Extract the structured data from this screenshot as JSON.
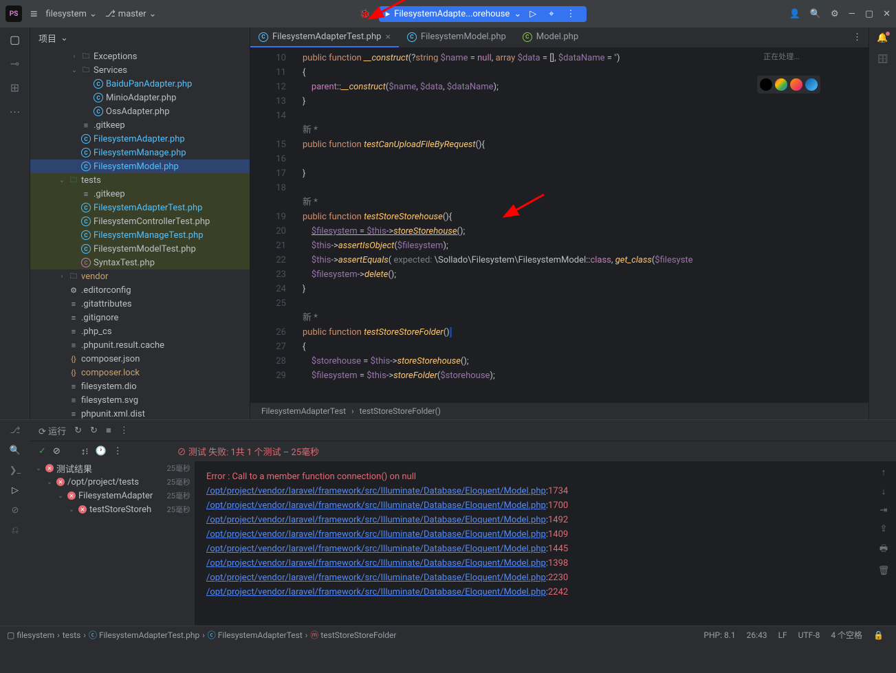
{
  "titlebar": {
    "project_name": "filesystem",
    "branch": "master",
    "run_config": "FilesystemAdapte...orehouse"
  },
  "project_panel": {
    "header": "项目",
    "tree": [
      {
        "indent": 2,
        "chev": "›",
        "icon": "folder",
        "label": "Exceptions",
        "cls": ""
      },
      {
        "indent": 2,
        "chev": "⌄",
        "icon": "folder",
        "label": "Services",
        "cls": ""
      },
      {
        "indent": 3,
        "chev": "",
        "icon": "php",
        "label": "BaiduPanAdapter.php",
        "cls": "blue"
      },
      {
        "indent": 3,
        "chev": "",
        "icon": "php",
        "label": "MinioAdapter.php",
        "cls": ""
      },
      {
        "indent": 3,
        "chev": "",
        "icon": "php",
        "label": "OssAdapter.php",
        "cls": ""
      },
      {
        "indent": 2,
        "chev": "",
        "icon": "file",
        "label": ".gitkeep",
        "cls": ""
      },
      {
        "indent": 2,
        "chev": "",
        "icon": "php",
        "label": "FilesystemAdapter.php",
        "cls": "blue"
      },
      {
        "indent": 2,
        "chev": "",
        "icon": "php",
        "label": "FilesystemManage.php",
        "cls": "blue"
      },
      {
        "indent": 2,
        "chev": "",
        "icon": "php",
        "label": "FilesystemModel.php",
        "cls": "blue",
        "selected": true
      },
      {
        "indent": 1,
        "chev": "⌄",
        "icon": "folder-green",
        "label": "tests",
        "cls": "",
        "hl": true
      },
      {
        "indent": 2,
        "chev": "",
        "icon": "file",
        "label": ".gitkeep",
        "cls": "",
        "hl": true
      },
      {
        "indent": 2,
        "chev": "",
        "icon": "php",
        "label": "FilesystemAdapterTest.php",
        "cls": "blue",
        "hl": true
      },
      {
        "indent": 2,
        "chev": "",
        "icon": "php",
        "label": "FilesystemControllerTest.php",
        "cls": "",
        "hl": true
      },
      {
        "indent": 2,
        "chev": "",
        "icon": "php",
        "label": "FilesystemManageTest.php",
        "cls": "blue",
        "hl": true
      },
      {
        "indent": 2,
        "chev": "",
        "icon": "php",
        "label": "FilesystemModelTest.php",
        "cls": "",
        "hl": true
      },
      {
        "indent": 2,
        "chev": "",
        "icon": "php-purple",
        "label": "SyntaxTest.php",
        "cls": "",
        "hl": true
      },
      {
        "indent": 1,
        "chev": "›",
        "icon": "folder",
        "label": "vendor",
        "cls": "yellow"
      },
      {
        "indent": 1,
        "chev": "",
        "icon": "gear",
        "label": ".editorconfig",
        "cls": ""
      },
      {
        "indent": 1,
        "chev": "",
        "icon": "file",
        "label": ".gitattributes",
        "cls": ""
      },
      {
        "indent": 1,
        "chev": "",
        "icon": "file",
        "label": ".gitignore",
        "cls": ""
      },
      {
        "indent": 1,
        "chev": "",
        "icon": "file",
        "label": ".php_cs",
        "cls": ""
      },
      {
        "indent": 1,
        "chev": "",
        "icon": "file",
        "label": ".phpunit.result.cache",
        "cls": ""
      },
      {
        "indent": 1,
        "chev": "",
        "icon": "json",
        "label": "composer.json",
        "cls": ""
      },
      {
        "indent": 1,
        "chev": "",
        "icon": "json",
        "label": "composer.lock",
        "cls": "yellow"
      },
      {
        "indent": 1,
        "chev": "",
        "icon": "file",
        "label": "filesystem.dio",
        "cls": ""
      },
      {
        "indent": 1,
        "chev": "",
        "icon": "file",
        "label": "filesystem.svg",
        "cls": ""
      },
      {
        "indent": 1,
        "chev": "",
        "icon": "file",
        "label": "phpunit.xml.dist",
        "cls": ""
      }
    ]
  },
  "tabs": [
    {
      "icon": "php",
      "label": "FilesystemAdapterTest.php",
      "active": true,
      "closable": true
    },
    {
      "icon": "php",
      "label": "FilesystemModel.php",
      "active": false,
      "closable": false
    },
    {
      "icon": "php-green",
      "label": "Model.php",
      "active": false,
      "closable": false
    }
  ],
  "status_processing": "正在处理...",
  "gutter_lines": [
    "10",
    "11",
    "12",
    "13",
    "14",
    "",
    "15",
    "16",
    "17",
    "18",
    "",
    "19",
    "20",
    "21",
    "22",
    "23",
    "24",
    "25",
    "",
    "26",
    "27",
    "28",
    "29"
  ],
  "code_lines": [
    {
      "html": "<span class='kw'>public</span> <span class='kw'>function</span> <span class='fn'>__construct</span>(?<span class='type'>string</span> <span class='var'>$name</span> = <span class='const'>null</span>, <span class='type'>array</span> <span class='var'>$data</span> = [], <span class='var'>$dataName</span> = <span class='str'>''</span>)"
    },
    {
      "html": "{"
    },
    {
      "html": "    <span class='const'>parent</span>::<span class='fn'>__construct</span>(<span class='var'>$name</span>, <span class='var'>$data</span>, <span class='var'>$dataName</span>);"
    },
    {
      "html": "}"
    },
    {
      "html": ""
    },
    {
      "html": "<span class='cmt'>新 *</span>"
    },
    {
      "html": "<span class='kw'>public</span> <span class='kw'>function</span> <span class='fn'>testCanUploadFileByRequest</span>(){"
    },
    {
      "html": ""
    },
    {
      "html": "}"
    },
    {
      "html": ""
    },
    {
      "html": "<span class='cmt'>新 *</span>"
    },
    {
      "html": "<span class='kw'>public</span> <span class='kw'>function</span> <span class='fn'>testStoreStorehouse</span>(){"
    },
    {
      "html": "    <span style='text-decoration:underline'><span class='var'>$filesystem</span> = <span class='var'>$this</span>-><span class='fn'>storeStorehouse</span>();</span>"
    },
    {
      "html": "    <span class='var'>$this</span>-><span class='fn'>assertIsObject</span>(<span class='var'>$filesystem</span>);"
    },
    {
      "html": "    <span class='var'>$this</span>-><span class='fn'>assertEquals</span>( <span class='param'>expected:</span> \\Sollado\\Filesystem\\<span class='op'>FilesystemModel</span>::<span class='const'>class</span>, <span class='fn'>get_class</span>(<span class='var'>$filesyste</span>"
    },
    {
      "html": "    <span class='var'>$filesystem</span>-><span class='fn'>delete</span>();"
    },
    {
      "html": "}"
    },
    {
      "html": ""
    },
    {
      "html": "<span class='cmt'>新 *</span>"
    },
    {
      "html": "<span class='kw'>public</span> <span class='kw'>function</span> <span class='fn'>testStoreStoreFolder</span>()<span style='background:#214283'>&nbsp;</span>"
    },
    {
      "html": "{"
    },
    {
      "html": "    <span class='var'>$storehouse</span> = <span class='var'>$this</span>-><span class='fn'>storeStorehouse</span>();"
    },
    {
      "html": "    <span class='var'>$filesystem</span> = <span class='var'>$this</span>-><span class='fn'>storeFolder</span>(<span class='var'>$storehouse</span>);"
    }
  ],
  "editor_breadcrumb": {
    "class": "FilesystemAdapterTest",
    "method": "testStoreStoreFolder()"
  },
  "run_toolbar": {
    "label": "运行"
  },
  "test_status": "测试 失败: 1共 1 个测试 – 25毫秒",
  "test_tree": [
    {
      "indent": 0,
      "label": "测试结果",
      "time": "25毫秒"
    },
    {
      "indent": 1,
      "label": "/opt/project/tests",
      "time": "25毫秒"
    },
    {
      "indent": 2,
      "label": "FilesystemAdapter",
      "time": "25毫秒"
    },
    {
      "indent": 3,
      "label": "testStoreStoreh",
      "time": "25毫秒"
    }
  ],
  "test_output": {
    "error": "Error : Call to a member function connection() on null",
    "stack": [
      {
        "path": "/opt/project/vendor/laravel/framework/src/Illuminate/Database/Eloquent/Model.php",
        "line": "1734"
      },
      {
        "path": "/opt/project/vendor/laravel/framework/src/Illuminate/Database/Eloquent/Model.php",
        "line": "1700"
      },
      {
        "path": "/opt/project/vendor/laravel/framework/src/Illuminate/Database/Eloquent/Model.php",
        "line": "1492"
      },
      {
        "path": "/opt/project/vendor/laravel/framework/src/Illuminate/Database/Eloquent/Model.php",
        "line": "1409"
      },
      {
        "path": "/opt/project/vendor/laravel/framework/src/Illuminate/Database/Eloquent/Model.php",
        "line": "1445"
      },
      {
        "path": "/opt/project/vendor/laravel/framework/src/Illuminate/Database/Eloquent/Model.php",
        "line": "1398"
      },
      {
        "path": "/opt/project/vendor/laravel/framework/src/Illuminate/Database/Eloquent/Model.php",
        "line": "2230"
      },
      {
        "path": "/opt/project/vendor/laravel/framework/src/Illuminate/Database/Eloquent/Model.php",
        "line": "2242"
      }
    ]
  },
  "statusbar": {
    "crumbs": [
      "filesystem",
      "tests",
      "FilesystemAdapterTest.php",
      "FilesystemAdapterTest",
      "testStoreStoreFolder"
    ],
    "right": [
      "PHP: 8.1",
      "26:43",
      "LF",
      "UTF-8",
      "4 个空格"
    ]
  }
}
